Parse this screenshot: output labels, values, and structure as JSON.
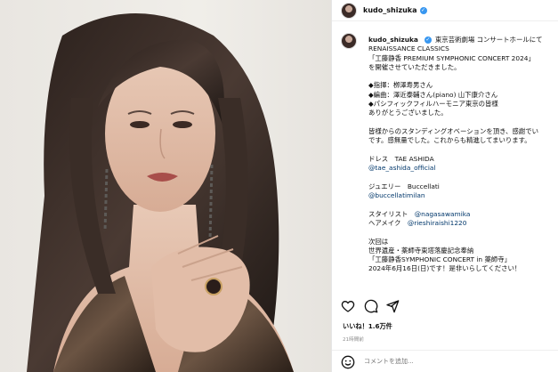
{
  "header": {
    "username": "kudo_shizuka"
  },
  "post": {
    "username": "kudo_shizuka",
    "caption_lines": [
      "東京芸術劇場 コンサートホールにて",
      "RENAISSANCE CLASSICS",
      "「工藤静香 PREMIUM SYMPHONIC CONCERT 2024」",
      "を開催させていただきました。",
      "",
      "◆指揮：栁澤寿男さん",
      "◆編曲：澤近泰輔さん(piano) 山下康介さん",
      "◆パシフィックフィルハーモニア東京の皆様",
      "ありがとうございました。",
      "",
      "皆様からのスタンディングオベーションを頂き、感謝でい",
      "です。感無量でした。これからも精進してまいります。",
      "",
      "ドレス　TAE ASHIDA",
      "@tae_ashida_official",
      "",
      "ジュエリー　Buccellati",
      "@buccellatimilan",
      "",
      "スタイリスト　@nagasawamika",
      "ヘアメイク　@rieshiraishi1220",
      "",
      "次回は",
      "世界遺産・薬師寺東塔落慶記念奉納",
      "「工藤静香SYMPHONIC CONCERT in 薬師寺」",
      "2024年6月16日(日)です！是非いらしてください！"
    ]
  },
  "likes": "いいね！1.6万件",
  "time_ago": "21時間前",
  "comment": {
    "placeholder": "コメントを追加..."
  },
  "icons": {
    "verified": "verified-badge-icon",
    "like": "heart-icon",
    "comment": "comment-bubble-icon",
    "share": "paper-plane-icon",
    "emoji": "smiley-icon"
  },
  "colors": {
    "verified_blue": "#3897f0",
    "link": "#00376b",
    "muted": "#8e8e8e"
  }
}
